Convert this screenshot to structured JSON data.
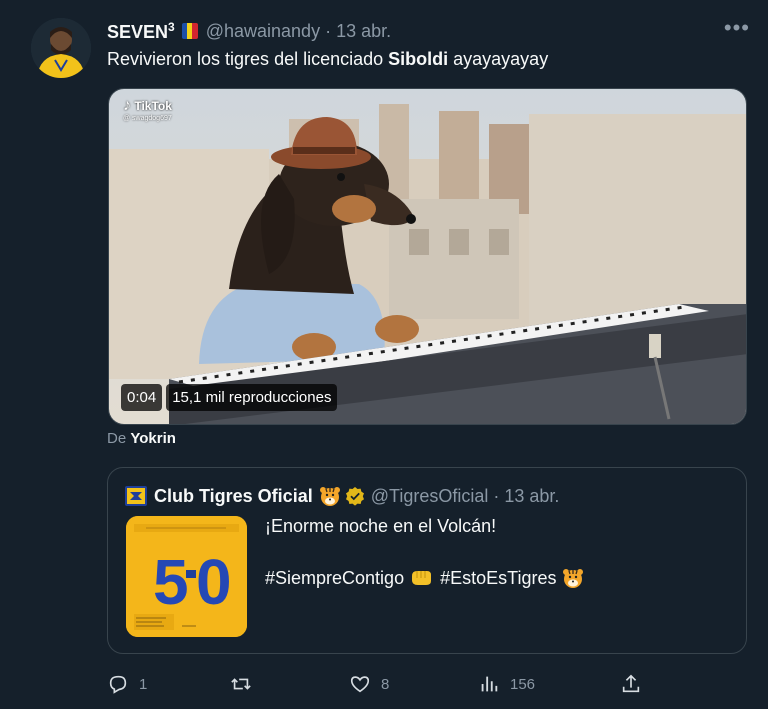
{
  "tweet": {
    "display_name": "SEVEN",
    "display_name_sup": "3",
    "handle": "@hawainandy",
    "separator": "·",
    "time": "13 abr.",
    "more_icon": "more-horizontal-icon",
    "text_before": "Revivieron los tigres del licenciado ",
    "text_bold": "Siboldi",
    "text_after": " ayayayayay"
  },
  "video": {
    "watermark": "TikTok",
    "watermark_user": "@ swagdog697",
    "duration": "0:04",
    "views": "15,1 mil reproducciones"
  },
  "attribution": {
    "prefix": "De",
    "source": "Yokrin"
  },
  "quote": {
    "name": "Club Tigres Oficial",
    "handle": "@TigresOficial",
    "separator": "·",
    "time": "13 abr.",
    "line1": "¡Enorme noche en el Volcán!",
    "line2_part1": "#SiempreContigo",
    "line2_part2": "#EstoEsTigres",
    "thumb_score": "5-0",
    "thumb_score_left": "5",
    "thumb_score_right": "0"
  },
  "actions": {
    "reply_count": "1",
    "retweet_count": "",
    "like_count": "8",
    "views_count": "156"
  },
  "colors": {
    "background": "#15202b",
    "text": "#f7f9f9",
    "secondary": "#8b98a5",
    "border": "#38444d",
    "tigres_gold": "#f4b61a",
    "tigres_blue": "#1f3f9a"
  }
}
